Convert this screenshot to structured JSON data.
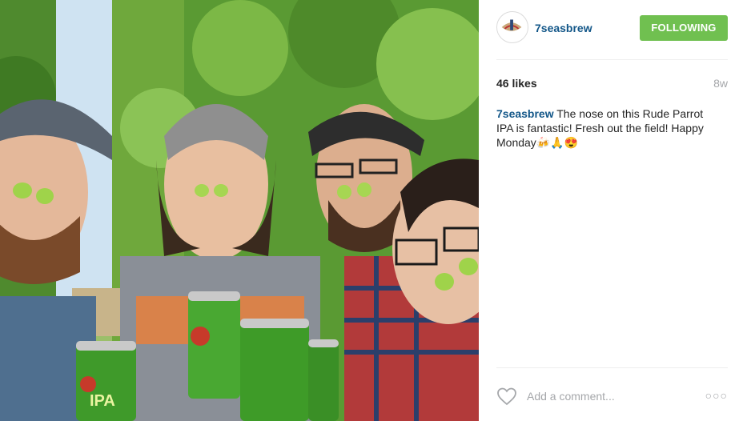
{
  "post": {
    "image_alt": "Four people holding hop cones to their noses, holding green cans, in a hop field",
    "can_label": "IPA"
  },
  "header": {
    "username": "7seasbrew",
    "follow_label": "FOLLOWING"
  },
  "meta": {
    "likes": "46 likes",
    "time": "8w"
  },
  "caption": {
    "username": "7seasbrew",
    "text": "The nose on this Rude Parrot IPA is fantastic! Fresh out the field! Happy Monday🍻🙏😍"
  },
  "comment": {
    "placeholder": "Add a comment...",
    "more_label": "○○○"
  },
  "colors": {
    "accent": "#70c050",
    "username": "#125688",
    "muted": "#a5a7aa"
  }
}
